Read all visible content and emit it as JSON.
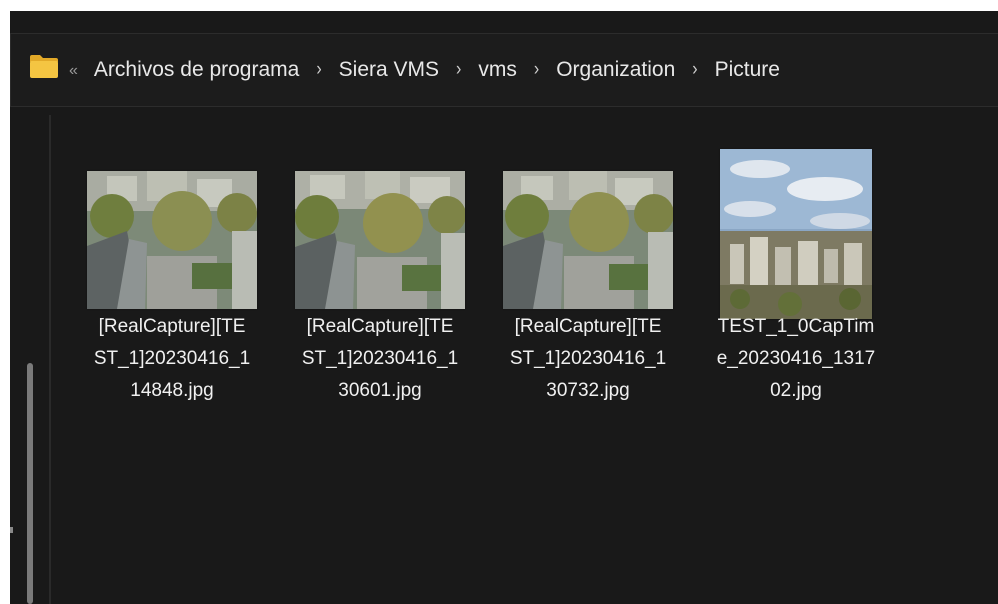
{
  "address_bar": {
    "overflow_glyph": "«",
    "separator": "›",
    "path": [
      "Archivos de programa",
      "Siera VMS",
      "vms",
      "Organization",
      "Picture"
    ]
  },
  "files": [
    {
      "name_lines": [
        "[RealCapture][TE",
        "ST_1]20230416_1",
        "14848.jpg"
      ],
      "thumbnail": "rooftop-camera-view"
    },
    {
      "name_lines": [
        "[RealCapture][TE",
        "ST_1]20230416_1",
        "30601.jpg"
      ],
      "thumbnail": "rooftop-camera-view"
    },
    {
      "name_lines": [
        "[RealCapture][TE",
        "ST_1]20230416_1",
        "30732.jpg"
      ],
      "thumbnail": "rooftop-camera-view"
    },
    {
      "name_lines": [
        "TEST_1_0CapTim",
        "e_20230416_1317",
        "02.jpg"
      ],
      "thumbnail": "city-skyline-view"
    }
  ],
  "colors": {
    "window_bg": "#191919",
    "text": "#f0f0f0",
    "folder_yellow": "#f4c542"
  }
}
